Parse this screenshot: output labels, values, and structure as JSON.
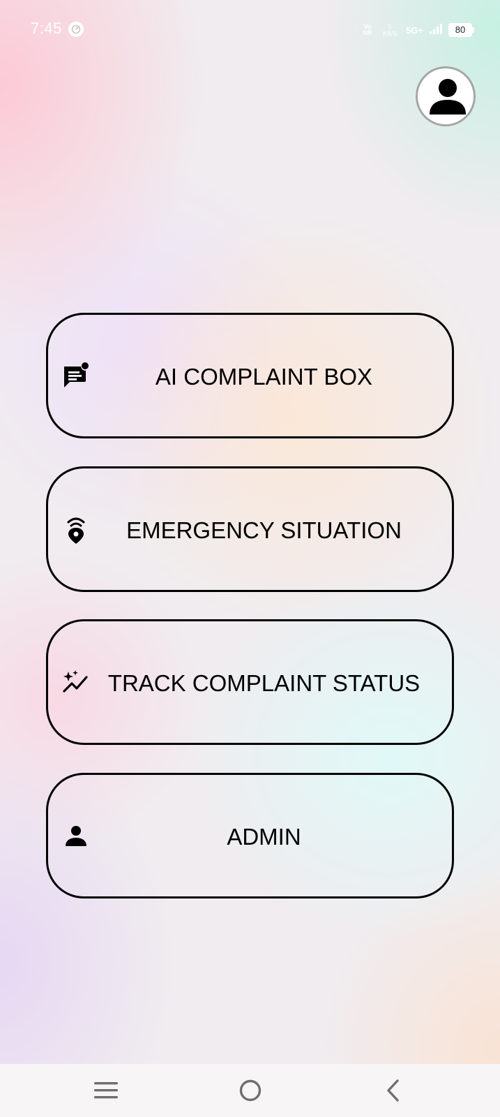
{
  "status_bar": {
    "time": "7:45",
    "volte_top": "Vo",
    "volte_bottom": "NR",
    "speed_value": "0",
    "speed_unit": "KB/S",
    "network": "5G+",
    "battery": "80"
  },
  "profile": {
    "icon": "account-circle-icon"
  },
  "menu": [
    {
      "label": "AI COMPLAINT BOX",
      "icon": "chat-message-icon"
    },
    {
      "label": "EMERGENCY SITUATION",
      "icon": "location-signal-icon"
    },
    {
      "label": "TRACK COMPLAINT STATUS",
      "icon": "sparkle-chart-icon"
    },
    {
      "label": "ADMIN",
      "icon": "person-icon"
    }
  ],
  "nav_bar": {
    "recents_icon": "menu-lines-icon",
    "home_icon": "circle-home-icon",
    "back_icon": "chevron-left-icon"
  },
  "colors": {
    "card_border": "#000000",
    "text": "#000000",
    "avatar_border": "#a6a6a6",
    "nav_icon": "#6f6f6f"
  }
}
